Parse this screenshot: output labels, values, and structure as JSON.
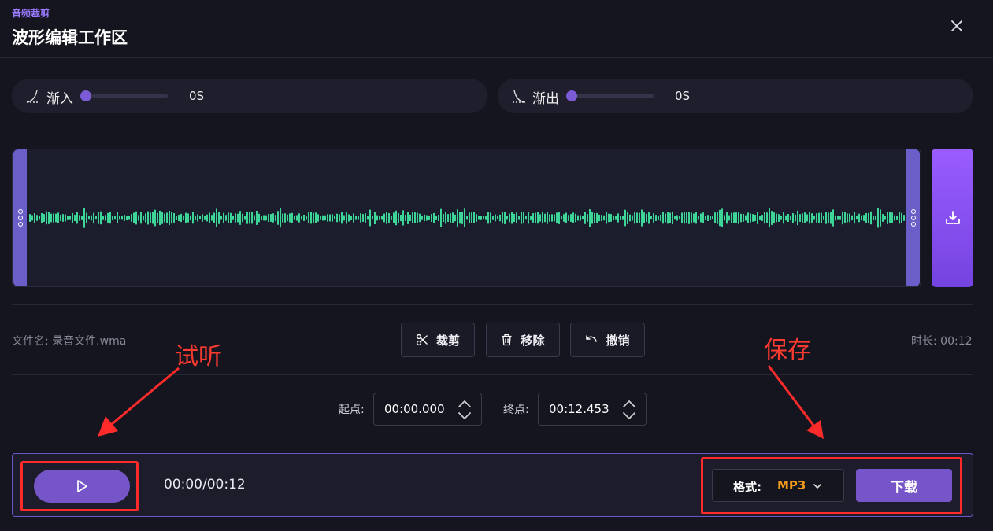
{
  "header": {
    "subtitle": "音频裁剪",
    "title": "波形编辑工作区",
    "close_icon": "close-icon"
  },
  "fade_in": {
    "label": "渐入",
    "value": "0S",
    "level": 0,
    "icon": "fade-in-curve-icon"
  },
  "fade_out": {
    "label": "渐出",
    "value": "0S",
    "level": 0,
    "icon": "fade-out-curve-icon"
  },
  "waveform": {
    "color": "#3ed598",
    "handle_color": "#6a5fc8"
  },
  "file": {
    "name_label": "文件名: 录音文件.wma",
    "duration_label": "时长: 00:12"
  },
  "tools": {
    "cut_label": "裁剪",
    "remove_label": "移除",
    "undo_label": "撤销"
  },
  "range": {
    "start_label": "起点:",
    "start_value": "00:00.000",
    "end_label": "终点:",
    "end_value": "00:12.453"
  },
  "annotations": {
    "listen": "试听",
    "save": "保存",
    "color": "#ff3b30"
  },
  "player": {
    "time": "00:00/00:12",
    "format_label": "格式:",
    "format_value": "MP3",
    "download_label": "下载"
  },
  "colors": {
    "accent": "#7555c8",
    "format_highlight": "#f29a1a"
  }
}
